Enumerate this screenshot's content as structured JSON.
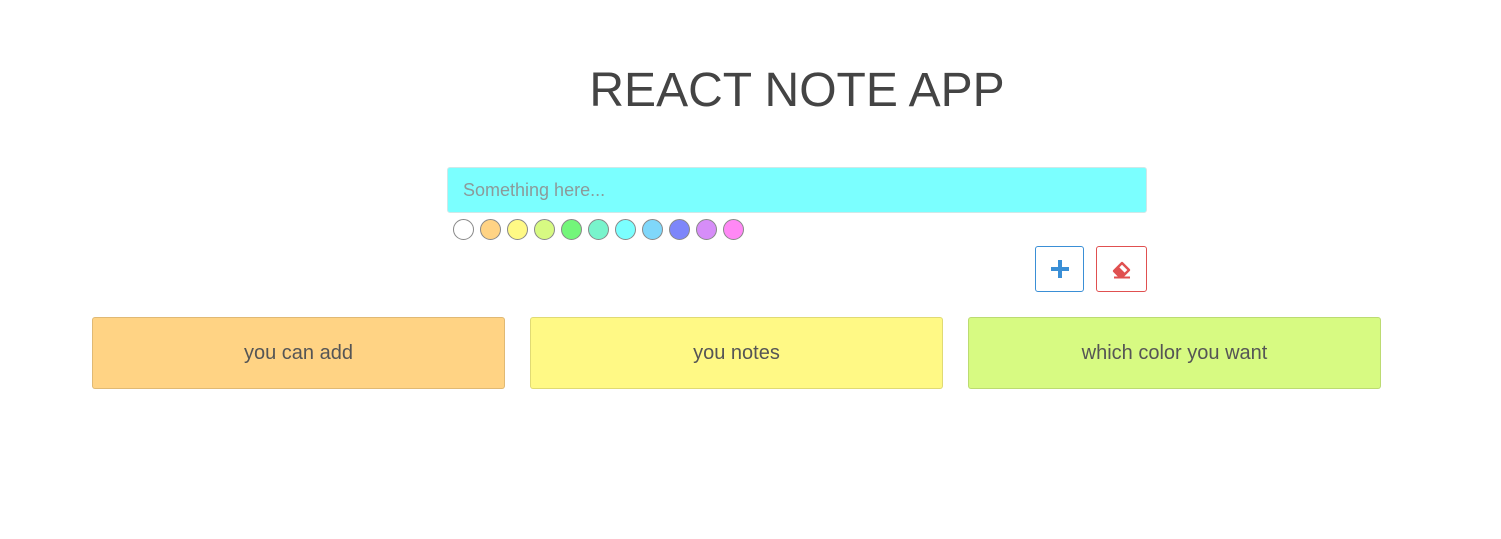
{
  "app": {
    "title": "REACT NOTE APP"
  },
  "editor": {
    "placeholder": "Something here...",
    "value": "",
    "selected_color": "#7bffff"
  },
  "palette": [
    {
      "name": "white",
      "color": "#ffffff"
    },
    {
      "name": "orange",
      "color": "#ffd384"
    },
    {
      "name": "yellow",
      "color": "#fff985"
    },
    {
      "name": "lime",
      "color": "#d7fa82"
    },
    {
      "name": "green",
      "color": "#73f67a"
    },
    {
      "name": "aquamarine",
      "color": "#78f4cc"
    },
    {
      "name": "cyan",
      "color": "#7bffff"
    },
    {
      "name": "sky",
      "color": "#7fd7fa"
    },
    {
      "name": "blue",
      "color": "#7d86fa"
    },
    {
      "name": "purple",
      "color": "#d68df8"
    },
    {
      "name": "pink",
      "color": "#ff88f5"
    }
  ],
  "toolbar": {
    "add_icon": "plus-icon",
    "add_color": "#3a8fd6",
    "erase_icon": "eraser-icon",
    "erase_color": "#e05050"
  },
  "notes": [
    {
      "text": "you can add",
      "color": "#ffd384"
    },
    {
      "text": "you notes",
      "color": "#fff985"
    },
    {
      "text": "which color you want",
      "color": "#d7fa82"
    }
  ]
}
